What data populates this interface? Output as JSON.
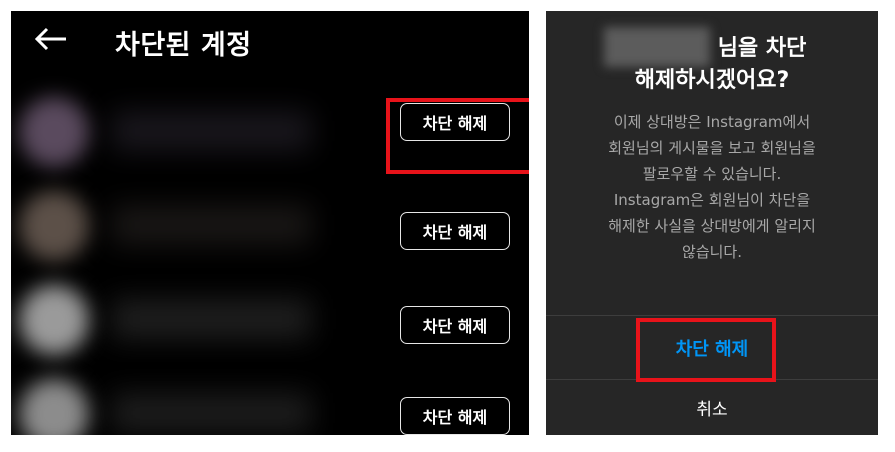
{
  "left": {
    "title": "차단된 계정",
    "back_icon": "arrow-left-icon",
    "unblock_label": "차단 해제",
    "accounts": [
      {
        "avatar_tone": "#5a4a5e"
      },
      {
        "avatar_tone": "#5c5048"
      },
      {
        "avatar_tone": "#9a9a9a"
      },
      {
        "avatar_tone": "#8c8c8c"
      }
    ]
  },
  "dialog": {
    "title_line1": "님을 차단",
    "title_line2": "해제하시겠어요?",
    "body_lines": [
      "이제 상대방은 Instagram에서",
      "회원님의 게시물을 보고 회원님을",
      "팔로우할 수 있습니다.",
      "Instagram은 회원님이 차단을",
      "해제한 사실을 상대방에게 알리지",
      "않습니다."
    ],
    "confirm_label": "차단 해제",
    "cancel_label": "취소"
  },
  "colors": {
    "accent": "#0095f6",
    "highlight": "#e8131a",
    "dialog_bg": "#262626"
  }
}
